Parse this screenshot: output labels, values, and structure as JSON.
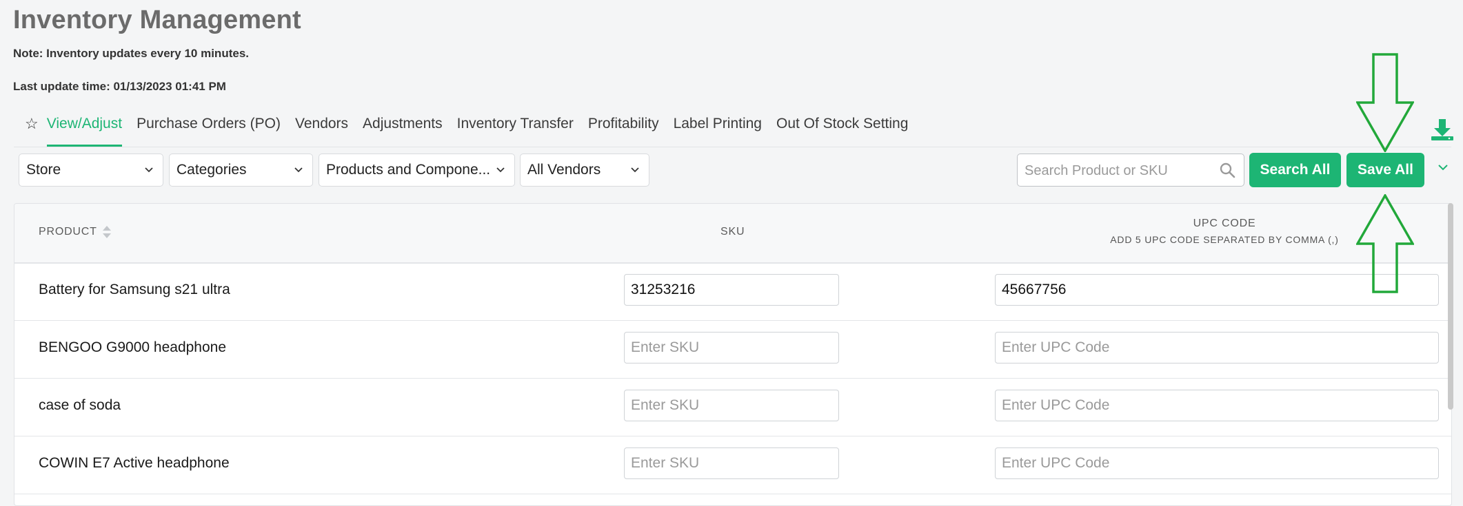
{
  "header": {
    "title": "Inventory Management",
    "note": "Note: Inventory updates every 10 minutes.",
    "last_update": "Last update time: 01/13/2023 01:41 PM"
  },
  "tabs": [
    {
      "label": "View/Adjust",
      "active": true
    },
    {
      "label": "Purchase Orders (PO)"
    },
    {
      "label": "Vendors"
    },
    {
      "label": "Adjustments"
    },
    {
      "label": "Inventory Transfer"
    },
    {
      "label": "Profitability"
    },
    {
      "label": "Label Printing"
    },
    {
      "label": "Out Of Stock Setting"
    }
  ],
  "filters": {
    "store": "Store",
    "categories": "Categories",
    "products": "Products and Compone...",
    "vendors": "All Vendors"
  },
  "search": {
    "placeholder": "Search Product or SKU"
  },
  "buttons": {
    "search_all": "Search All",
    "save_all": "Save All"
  },
  "table": {
    "headers": {
      "product": "PRODUCT",
      "sku": "SKU",
      "upc": "UPC CODE",
      "upc_sub": "ADD 5 UPC CODE SEPARATED BY COMMA (,)"
    },
    "sku_placeholder": "Enter SKU",
    "upc_placeholder": "Enter UPC Code",
    "rows": [
      {
        "product": "Battery for Samsung s21 ultra",
        "sku": "31253216",
        "upc": "45667756"
      },
      {
        "product": "BENGOO G9000 headphone",
        "sku": "",
        "upc": ""
      },
      {
        "product": "case of soda",
        "sku": "",
        "upc": ""
      },
      {
        "product": "COWIN E7 Active headphone",
        "sku": "",
        "upc": ""
      }
    ]
  },
  "colors": {
    "accent": "#1db574",
    "annotation_arrow": "#22a83a"
  },
  "icons": [
    "star-icon",
    "download-icon",
    "chevron-down-icon",
    "search-icon",
    "sort-icon",
    "arrow-down-annotation",
    "arrow-up-annotation"
  ]
}
